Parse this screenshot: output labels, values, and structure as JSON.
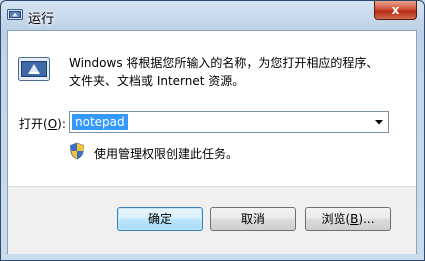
{
  "window": {
    "title": "运行",
    "close_label": "x"
  },
  "description": {
    "line1": "Windows 将根据您所输入的名称，为您打开相应的程序、",
    "line2": "文件夹、文档或 Internet 资源。"
  },
  "open": {
    "label_prefix": "打开(",
    "label_accel": "O",
    "label_suffix": "):",
    "value": "notepad"
  },
  "admin_note": "使用管理权限创建此任务。",
  "buttons": {
    "ok": "确定",
    "cancel": "取消",
    "browse_prefix": "浏览(",
    "browse_accel": "B",
    "browse_suffix": ")..."
  },
  "icons": {
    "title": "run-app-icon",
    "program": "run-program-icon",
    "shield": "uac-shield-icon",
    "dropdown": "dropdown-arrow-icon"
  }
}
